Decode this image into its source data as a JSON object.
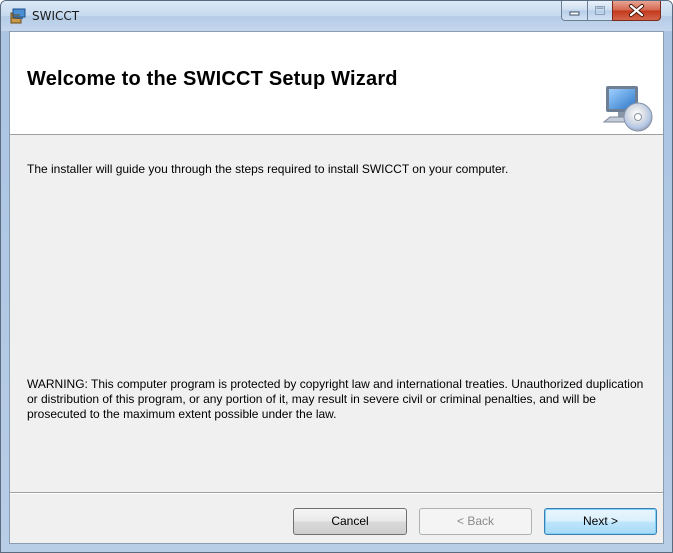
{
  "window": {
    "title": "SWICCT",
    "controls": {
      "minimize": "minimize",
      "maximize": "maximize",
      "close": "close"
    }
  },
  "banner": {
    "title": "Welcome to the SWICCT Setup Wizard",
    "icon": "computer-cd-icon"
  },
  "body": {
    "intro": "The installer will guide you through the steps required to install SWICCT on your computer.",
    "warning": "WARNING: This computer program is protected by copyright law and international treaties. Unauthorized duplication or distribution of this program, or any portion of it, may result in severe civil or criminal penalties, and will be prosecuted to the maximum extent possible under the law."
  },
  "buttons": {
    "cancel": "Cancel",
    "back": "< Back",
    "next": "Next >"
  },
  "colors": {
    "dialog_background": "#f0f0f0",
    "banner_background": "#ffffff",
    "close_button": "#c4371b",
    "default_button_border": "#3c7fb1"
  }
}
